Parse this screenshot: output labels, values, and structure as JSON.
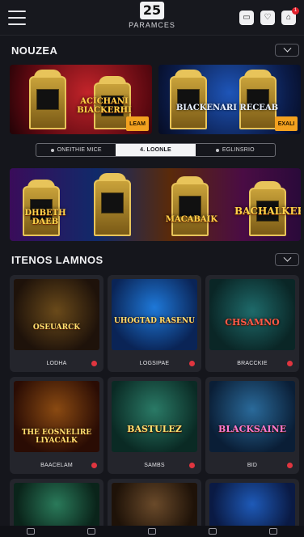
{
  "header": {
    "logo_number": "25",
    "logo_text": "PARAMCES",
    "icons": [
      "menu-icon",
      "wallet-icon",
      "gift-icon",
      "notification-icon"
    ],
    "notification_count": "1"
  },
  "section1": {
    "title": "NOUZEA"
  },
  "featured": [
    {
      "title": "ACICHANI BIACKERHI",
      "button": "LEAM"
    },
    {
      "title": "BIACKENARI RECEAB",
      "button": "EXALI"
    }
  ],
  "tabs": [
    {
      "label": "ONEITHIE MICE",
      "active": false
    },
    {
      "label": "4. LOONLE",
      "active": true
    },
    {
      "label": "EGLINSRIO",
      "active": false
    }
  ],
  "promo_banner": {
    "titles": [
      "DHBETH DAEB",
      "MACABAIK",
      "BACHALKER"
    ]
  },
  "section2": {
    "title": "ITENOS LAMNOS"
  },
  "games": [
    {
      "title": "OSEUARCK",
      "label": "LODHA"
    },
    {
      "title": "UHOGTAD RASENU",
      "label": "LOGSIPAE"
    },
    {
      "title": "CHSAMNO",
      "label": "BRACCKIE"
    },
    {
      "title": "THE EOSNELIRE LIYACALK",
      "label": "BAACELAM"
    },
    {
      "title": "BASTULEZ",
      "label": "SAMBS"
    },
    {
      "title": "BLACKSAINE",
      "label": "BID"
    }
  ],
  "colors": {
    "background": "#15161c",
    "accent_orange": "#f3a11f",
    "gold": "#ffd24a",
    "favorite_red": "#e0353f"
  }
}
